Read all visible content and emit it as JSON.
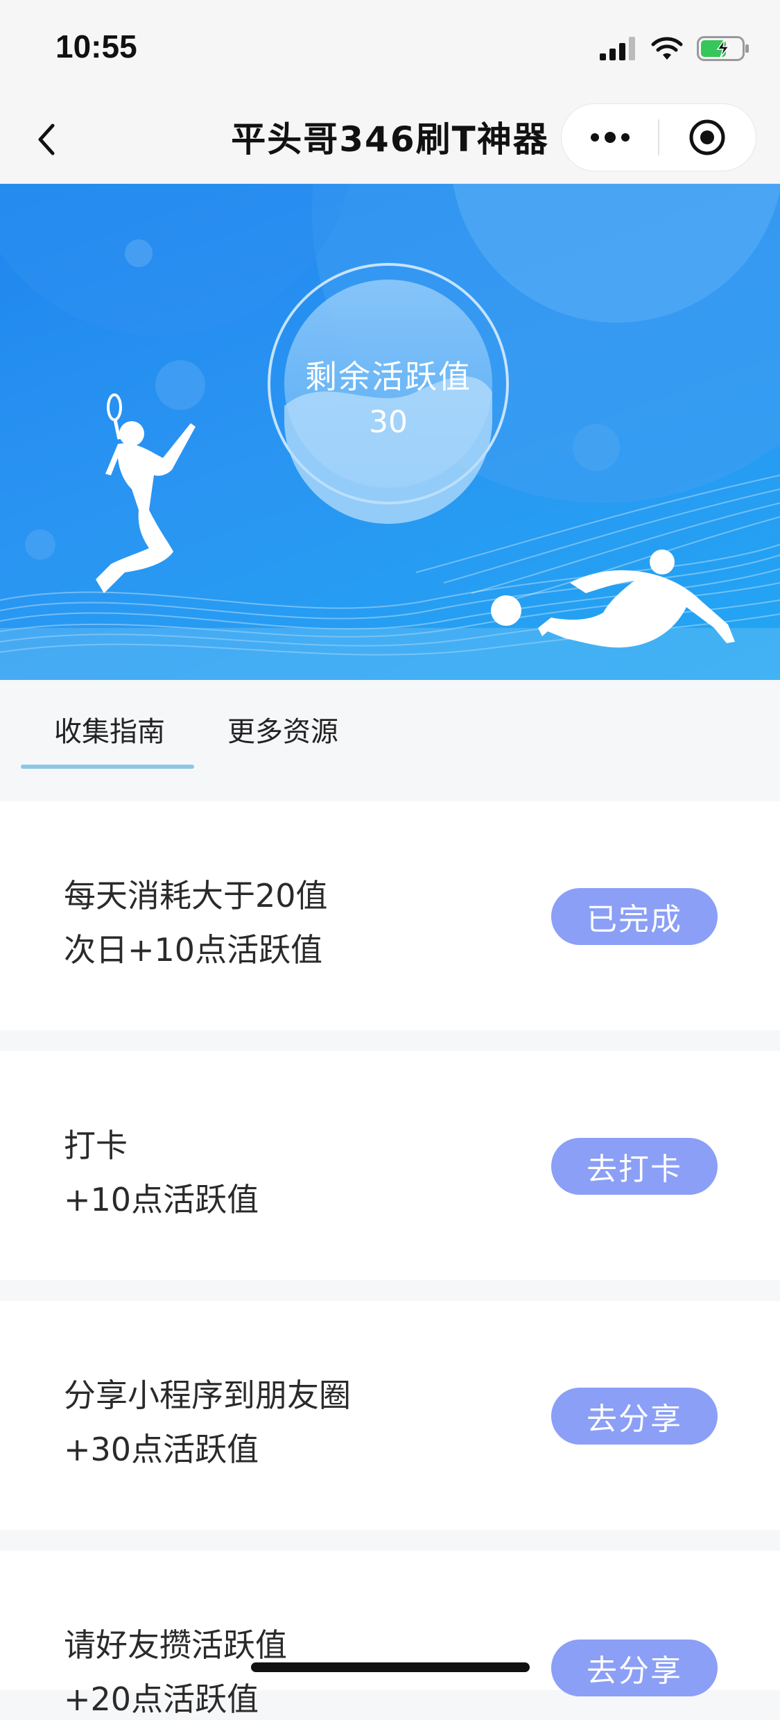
{
  "status_bar": {
    "time": "10:55"
  },
  "nav": {
    "title": "平头哥346刷T神器",
    "back_icon": "chevron-left-icon",
    "more_icon": "more-dots-icon",
    "close_icon": "record-circle-icon"
  },
  "hero": {
    "label": "剩余活跃值",
    "value": "30",
    "colors": {
      "background": "#2a94f2",
      "circle": "#6bb6f7"
    }
  },
  "tabs": [
    {
      "label": "收集指南",
      "active": true
    },
    {
      "label": "更多资源",
      "active": false
    }
  ],
  "tasks": [
    {
      "line1": "每天消耗大于20值",
      "line2": "次日+10点活跃值",
      "button": "已完成"
    },
    {
      "line1": "打卡",
      "line2": "+10点活跃值",
      "button": "去打卡"
    },
    {
      "line1": "分享小程序到朋友圈",
      "line2": "+30点活跃值",
      "button": "去分享"
    },
    {
      "line1": "请好友攒活跃值",
      "line2": "+20点活跃值",
      "button": "去分享"
    }
  ],
  "colors": {
    "accent_button": "#8b9ff6",
    "tab_underline": "#8cc7e6"
  }
}
